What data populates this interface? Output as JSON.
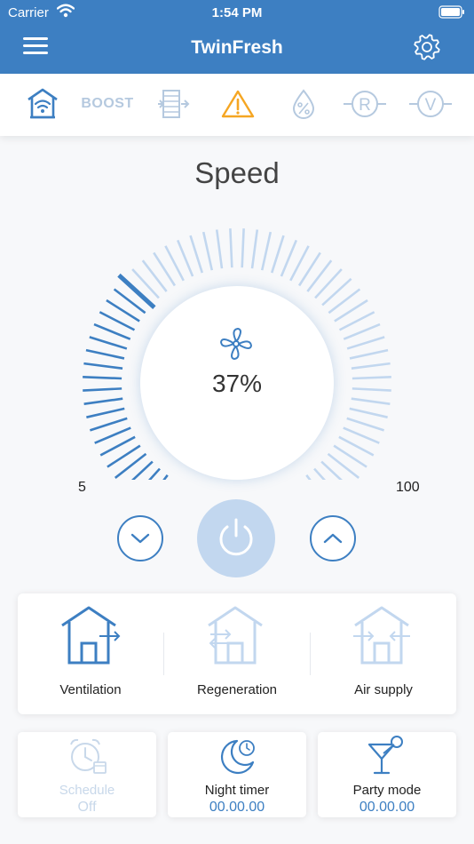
{
  "status_bar": {
    "carrier": "Carrier",
    "time": "1:54 PM"
  },
  "header": {
    "title": "TwinFresh",
    "menu_icon": "hamburger-menu-icon",
    "settings_icon": "gear-icon"
  },
  "mode_bar": {
    "items": [
      {
        "name": "home-wifi-icon",
        "active": true
      },
      {
        "name": "boost",
        "label": "BOOST",
        "active": false
      },
      {
        "name": "filter-icon",
        "active": false
      },
      {
        "name": "warning-icon",
        "active": true,
        "color": "#f5a623"
      },
      {
        "name": "humidity-icon",
        "active": false
      },
      {
        "name": "r-icon",
        "label": "R",
        "active": false
      },
      {
        "name": "v-icon",
        "label": "V",
        "active": false
      }
    ]
  },
  "speed": {
    "title": "Speed",
    "value_text": "37%",
    "value": 37,
    "min_label": "5",
    "max_label": "100",
    "min": 5,
    "max": 100
  },
  "controls": {
    "down_icon": "chevron-down-icon",
    "power_icon": "power-icon",
    "up_icon": "chevron-up-icon"
  },
  "modes": [
    {
      "label": "Ventilation",
      "active": true
    },
    {
      "label": "Regeneration",
      "active": false
    },
    {
      "label": "Air supply",
      "active": false
    }
  ],
  "cards": {
    "schedule": {
      "label": "Schedule",
      "value": "Off",
      "enabled": false
    },
    "night_timer": {
      "label": "Night timer",
      "value": "00.00.00",
      "enabled": true
    },
    "party_mode": {
      "label": "Party mode",
      "value": "00.00.00",
      "enabled": true
    }
  },
  "colors": {
    "primary": "#3d7fc2",
    "inactive": "#b5c9df",
    "warning": "#f5a623",
    "light": "#c2d7ef"
  }
}
